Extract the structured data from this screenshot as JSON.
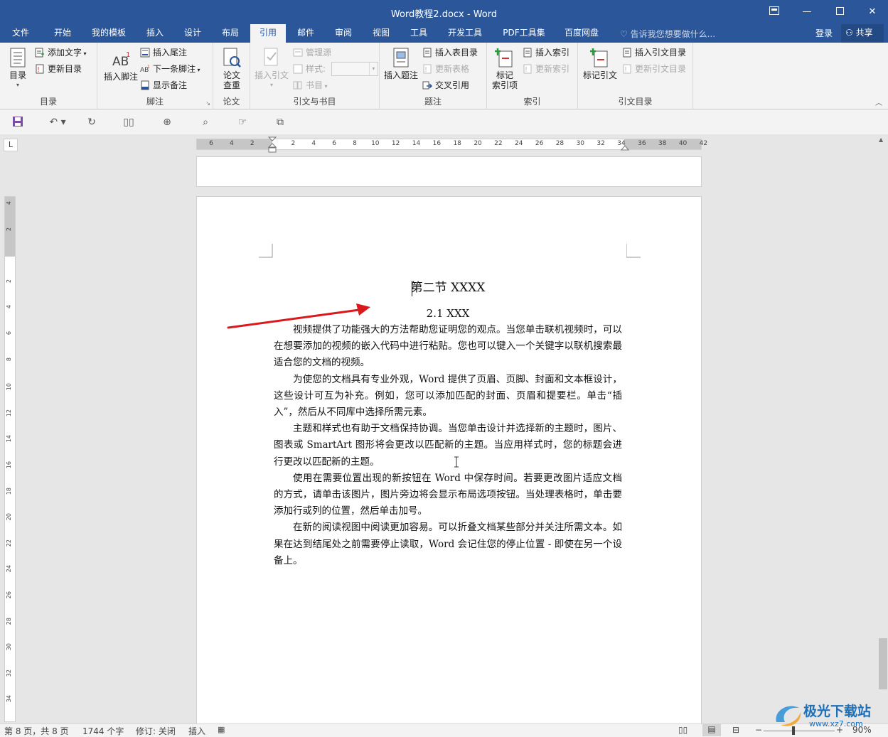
{
  "titlebar": {
    "title": "Word教程2.docx - Word",
    "buttons": [
      "restore-ribbon",
      "minimize",
      "maximize",
      "close"
    ]
  },
  "tabs": [
    "文件",
    "开始",
    "我的模板",
    "插入",
    "设计",
    "布局",
    "引用",
    "邮件",
    "审阅",
    "视图",
    "工具",
    "开发工具",
    "PDF工具集",
    "百度网盘"
  ],
  "active_tab": "引用",
  "tell_me": "告诉我您想要做什么...",
  "login": "登录",
  "share": "共享",
  "ribbon": {
    "toc": {
      "label": "目录",
      "big": "目录",
      "add_text": "添加文字",
      "update": "更新目录"
    },
    "footnotes": {
      "label": "脚注",
      "insert_footnote": "插入脚注",
      "insert_endnote": "插入尾注",
      "next_footnote": "下一条脚注",
      "show_notes": "显示备注"
    },
    "paper": {
      "label": "论文",
      "check": "论文\n查重",
      "check_l1": "论文",
      "check_l2": "查重"
    },
    "citations": {
      "label": "引文与书目",
      "insert_citation": "插入引文",
      "manage_sources": "管理源",
      "style": "样式:",
      "bibliography": "书目"
    },
    "captions": {
      "label": "题注",
      "insert_caption": "插入题注",
      "insert_tof": "插入表目录",
      "update_table": "更新表格",
      "cross_ref": "交叉引用"
    },
    "index": {
      "label": "索引",
      "mark_entry_l1": "标记",
      "mark_entry_l2": "索引项",
      "insert_index": "插入索引",
      "update_index": "更新索引"
    },
    "toa": {
      "label": "引文目录",
      "mark_citation": "标记引文",
      "insert_toa": "插入引文目录",
      "update_toa": "更新引文目录"
    }
  },
  "ruler": {
    "h_ticks": [
      "6",
      "4",
      "2",
      "",
      "2",
      "4",
      "6",
      "8",
      "10",
      "12",
      "14",
      "16",
      "18",
      "20",
      "22",
      "24",
      "26",
      "28",
      "30",
      "32",
      "34",
      "36",
      "38",
      "40",
      "42"
    ],
    "v_ticks": [
      "4",
      "2",
      "",
      "2",
      "4",
      "6",
      "8",
      "10",
      "12",
      "14",
      "16",
      "18",
      "20",
      "22",
      "24",
      "26",
      "28",
      "30",
      "32",
      "34"
    ],
    "corner": "L"
  },
  "document": {
    "heading1": "第二节  XXXX",
    "heading2": "2.1 XXX",
    "paragraphs": [
      "视频提供了功能强大的方法帮助您证明您的观点。当您单击联机视频时，可以在想要添加的视频的嵌入代码中进行粘贴。您也可以键入一个关键字以联机搜索最适合您的文档的视频。",
      "为使您的文档具有专业外观，Word 提供了页眉、页脚、封面和文本框设计，这些设计可互为补充。例如，您可以添加匹配的封面、页眉和提要栏。单击“插入”，然后从不同库中选择所需元素。",
      "主题和样式也有助于文档保持协调。当您单击设计并选择新的主题时，图片、图表或 SmartArt 图形将会更改以匹配新的主题。当应用样式时，您的标题会进行更改以匹配新的主题。",
      "使用在需要位置出现的新按钮在 Word 中保存时间。若要更改图片适应文档的方式，请单击该图片，图片旁边将会显示布局选项按钮。当处理表格时，单击要添加行或列的位置，然后单击加号。",
      "在新的阅读视图中阅读更加容易。可以折叠文档某些部分并关注所需文本。如果在达到结尾处之前需要停止读取，Word 会记住您的停止位置 - 即使在另一个设备上。"
    ]
  },
  "status": {
    "page": "第 8 页，共 8 页",
    "words": "1744 个字",
    "track": "修订: 关闭",
    "mode": "插入",
    "zoom": "90%"
  },
  "watermark": {
    "text": "极光下载站",
    "url": "www.xz7.com"
  },
  "colors": {
    "accent": "#2b579a",
    "arrow": "#d9191c"
  }
}
